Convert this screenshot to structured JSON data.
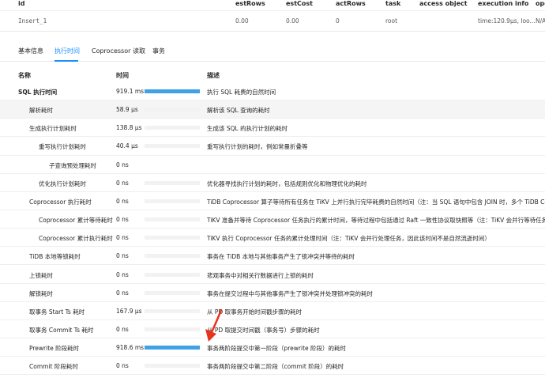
{
  "top_table": {
    "headers": [
      "id",
      "estRows",
      "estCost",
      "actRows",
      "task",
      "access object",
      "execution info",
      "ope"
    ],
    "row": [
      "Insert_1",
      "0.00",
      "0.00",
      "0",
      "root",
      "",
      "time:120.9µs, loo...",
      "N/A"
    ]
  },
  "tabs": [
    "基本信息",
    "执行时间",
    "Coprocessor 读取",
    "事务"
  ],
  "timing_table": {
    "headers": [
      "名称",
      "时间",
      "描述"
    ],
    "rows": [
      {
        "name": "SQL 执行时间",
        "time": "919.1 ms",
        "fraction": 1.0,
        "desc": "执行 SQL 耗费的自然时间"
      },
      {
        "name": "解析耗时",
        "time": "58.9 µs",
        "fraction": 0.0,
        "desc": "解析该 SQL 查询的耗时"
      },
      {
        "name": "生成执行计划耗时",
        "time": "138.8 µs",
        "fraction": 0.0,
        "desc": "生成该 SQL 的执行计划的耗时"
      },
      {
        "name": "重写执行计划耗时",
        "time": "40.4 µs",
        "fraction": 0.0,
        "desc": "重写执行计划的耗时，例如常量折叠等"
      },
      {
        "name": "子查询预处理耗时",
        "time": "0 ns",
        "fraction": 0.0,
        "desc": ""
      },
      {
        "name": "优化执行计划耗时",
        "time": "0 ns",
        "fraction": 0.0,
        "desc": "优化器寻找执行计划的耗时，包括规则优化和物理优化的耗时"
      },
      {
        "name": "Coprocessor 执行耗时",
        "time": "0 ns",
        "fraction": 0.0,
        "desc": "TiDB Coprocessor 算子等待所有任务在 TiKV 上并行执行完毕耗费的自然时间（注：当 SQL 语句中包含 JOIN 时，多个 TiDB Coprocessor 算子"
      },
      {
        "name": "Coprocessor 累计等待耗时",
        "time": "0 ns",
        "fraction": 0.0,
        "desc": "TiKV 准备并等待 Coprocessor 任务执行的累计时间，等待过程中包括通过 Raft 一致性协议取快照等（注：TiKV 会并行等待任务，因此该时间不"
      },
      {
        "name": "Coprocessor 累计执行耗时",
        "time": "0 ns",
        "fraction": 0.0,
        "desc": "TiKV 执行 Coprocessor 任务的累计处理时间（注：TiKV 会并行处理任务，因此该时间不是自然流逝时间）"
      },
      {
        "name": "TiDB 本地等锁耗时",
        "time": "0 ns",
        "fraction": 0.0,
        "desc": "事务在 TiDB 本地与其他事务产生了锁冲突并等待的耗时"
      },
      {
        "name": "上锁耗时",
        "time": "0 ns",
        "fraction": 0.0,
        "desc": "悲观事务中对相关行数据进行上锁的耗时"
      },
      {
        "name": "解锁耗时",
        "time": "0 ns",
        "fraction": 0.0,
        "desc": "事务在提交过程中与其他事务产生了锁冲突并处理锁冲突的耗时"
      },
      {
        "name": "取事务 Start Ts 耗时",
        "time": "167.9 µs",
        "fraction": 0.0,
        "desc": "从 PD 取事务开始时间戳步骤的耗时"
      },
      {
        "name": "取事务 Commit Ts 耗时",
        "time": "0 ns",
        "fraction": 0.0,
        "desc": "从 PD 取提交时间戳（事务号）步骤的耗时"
      },
      {
        "name": "Prewrite 阶段耗时",
        "time": "918.6 ms",
        "fraction": 1.0,
        "desc": "事务两阶段提交中第一阶段（prewrite 阶段）的耗时"
      },
      {
        "name": "Commit 阶段耗时",
        "time": "0 ns",
        "fraction": 0.0,
        "desc": "事务两阶段提交中第二阶段（commit 阶段）的耗时"
      }
    ]
  },
  "colors": {
    "accent": "#1890ff",
    "bar": "#3fa2e6",
    "arrow": "#e8321e",
    "highlight_row": "#f5f5f5"
  }
}
